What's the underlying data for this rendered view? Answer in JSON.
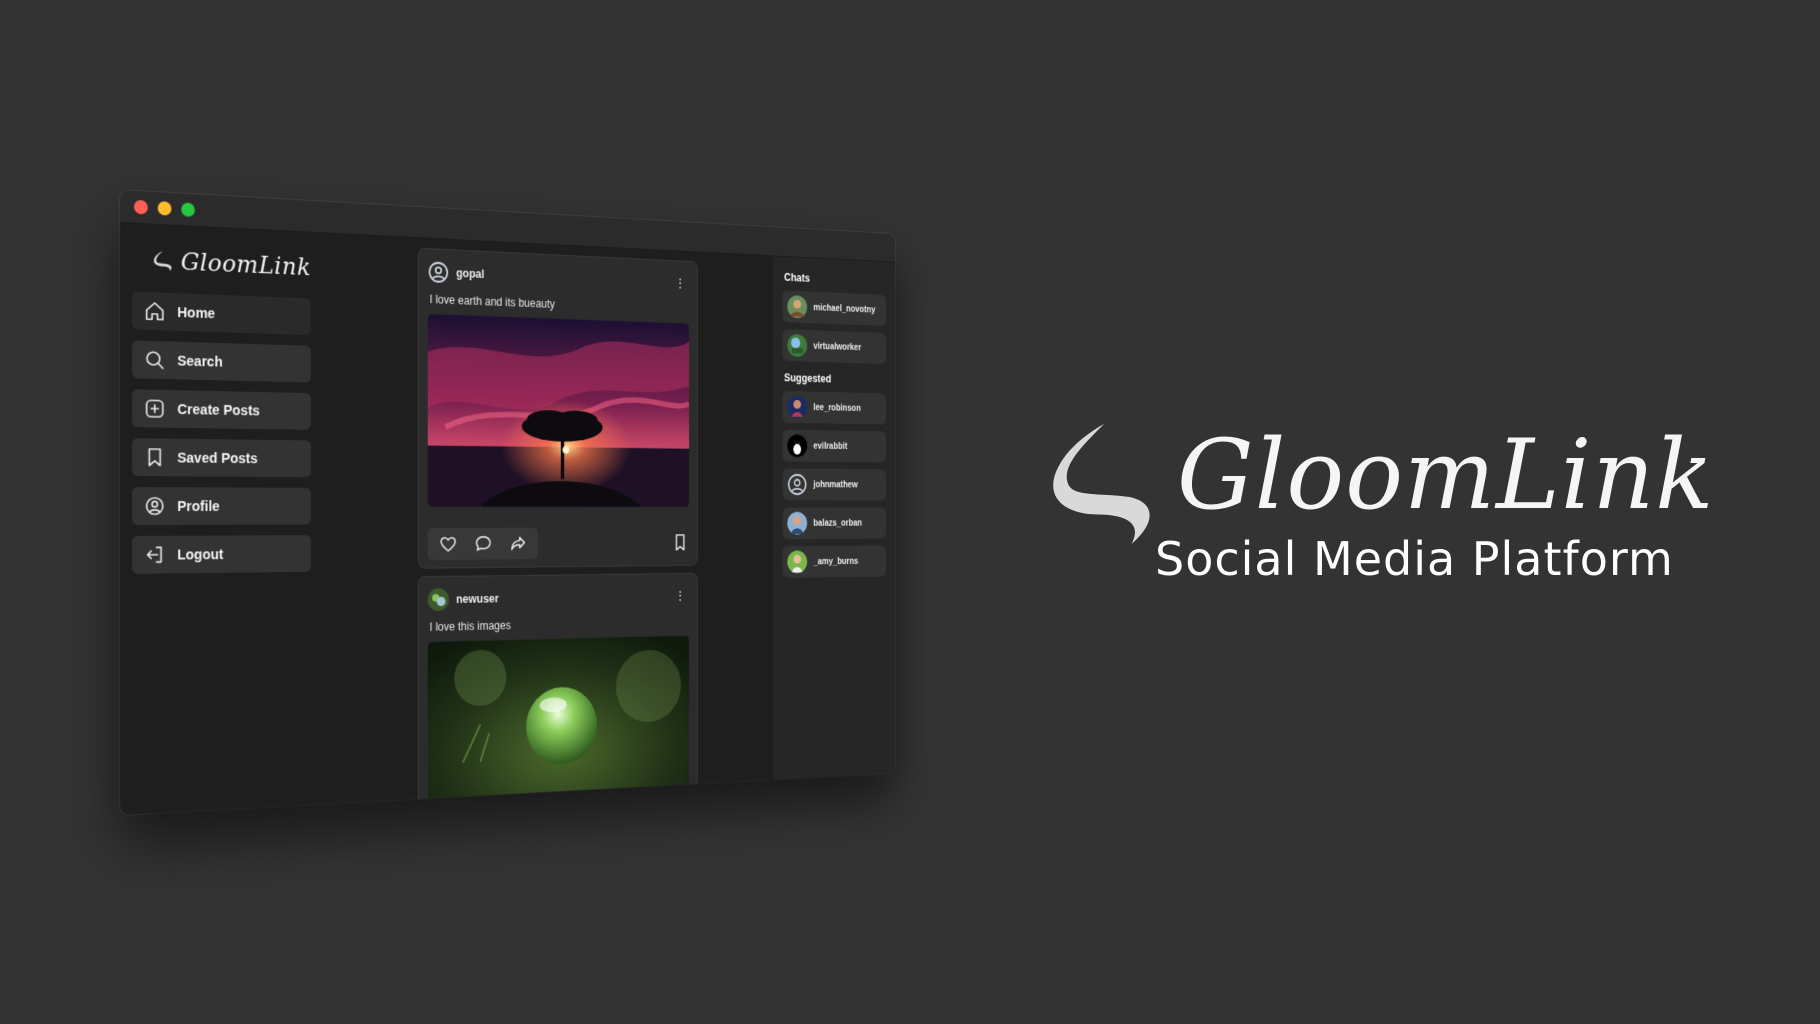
{
  "app": {
    "brand": "GloomLink"
  },
  "sidebar": {
    "items": [
      {
        "label": "Home",
        "icon": "home-icon"
      },
      {
        "label": "Search",
        "icon": "search-icon"
      },
      {
        "label": "Create Posts",
        "icon": "plus-square-icon"
      },
      {
        "label": "Saved Posts",
        "icon": "bookmark-icon"
      },
      {
        "label": "Profile",
        "icon": "user-circle-icon"
      },
      {
        "label": "Logout",
        "icon": "logout-icon"
      }
    ]
  },
  "feed": {
    "posts": [
      {
        "username": "gopal",
        "caption": "I love earth and its bueauty",
        "image": "sunset-tree"
      },
      {
        "username": "newuser",
        "caption": "I love this images",
        "image": "glass-orb"
      }
    ]
  },
  "rightpanel": {
    "chats_title": "Chats",
    "chats": [
      {
        "name": "michael_novotny"
      },
      {
        "name": "virtualworker"
      }
    ],
    "suggested_title": "Suggested",
    "suggested": [
      {
        "name": "lee_robinson"
      },
      {
        "name": "evilrabbit"
      },
      {
        "name": "johnmathew"
      },
      {
        "name": "balazs_orban"
      },
      {
        "name": "_amy_burns"
      }
    ]
  },
  "hero": {
    "title": "GloomLink",
    "subtitle": "Social Media Platform"
  },
  "colors": {
    "background": "#333333",
    "window": "#1e1e1e",
    "card": "#2c2c2c",
    "nav_item": "#333333"
  }
}
